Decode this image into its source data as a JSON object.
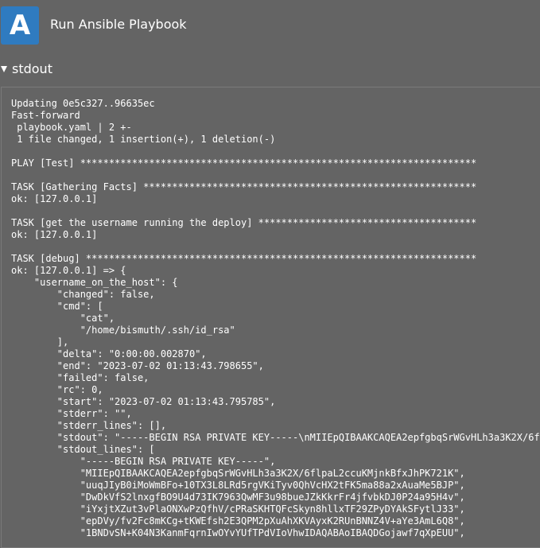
{
  "app": {
    "logo_letter": "A",
    "title": "Run Ansible Playbook"
  },
  "section": {
    "label": "stdout",
    "expanded": true
  },
  "stdout_lines": [
    "Updating 0e5c327..96635ec",
    "Fast-forward",
    " playbook.yaml | 2 +-",
    " 1 file changed, 1 insertion(+), 1 deletion(-)",
    "",
    "PLAY [Test] *********************************************************************",
    "",
    "TASK [Gathering Facts] **********************************************************",
    "ok: [127.0.0.1]",
    "",
    "TASK [get the username running the deploy] **************************************",
    "ok: [127.0.0.1]",
    "",
    "TASK [debug] ********************************************************************",
    "ok: [127.0.0.1] => {",
    "    \"username_on_the_host\": {",
    "        \"changed\": false,",
    "        \"cmd\": [",
    "            \"cat\",",
    "            \"/home/bismuth/.ssh/id_rsa\"",
    "        ],",
    "        \"delta\": \"0:00:00.002870\",",
    "        \"end\": \"2023-07-02 01:13:43.798655\",",
    "        \"failed\": false,",
    "        \"rc\": 0,",
    "        \"start\": \"2023-07-02 01:13:43.795785\",",
    "        \"stderr\": \"\",",
    "        \"stderr_lines\": [],",
    "        \"stdout\": \"-----BEGIN RSA PRIVATE KEY-----\\nMIIEpQIBAAKCAQEA2epfgbqSrWGvHLh3a3K2X/6f",
    "        \"stdout_lines\": [",
    "            \"-----BEGIN RSA PRIVATE KEY-----\",",
    "            \"MIIEpQIBAAKCAQEA2epfgbqSrWGvHLh3a3K2X/6flpaL2ccuKMjnkBfxJhPK721K\",",
    "            \"uuqJIyB0iMoWmBFo+10TX3L8LRd5rgVKiTyv0QhVcHX2tFK5ma88a2xAuaMe5BJP\",",
    "            \"DwDkVfS2lnxgfBO9U4d73IK7963QwMF3u98bueJZkKkrFr4jfvbkDJ0P24a95H4v\",",
    "            \"iYxjtXZut3vPlaONXwPzQfhV/cPRaSKHTQFcSkyn8hllxTF29ZPyDYAkSFytlJ33\",",
    "            \"epDVy/fv2Fc8mKCg+tKWEfsh2E3QPM2pXuAhXKVAyxK2RUnBNNZ4V+aYe3AmL6Q8\",",
    "            \"1BNDvSN+K04N3KanmFqrnIwOYvYUfTPdVIoVhwIDAQABAoIBAQDGojawf7qXpEUU\","
  ]
}
